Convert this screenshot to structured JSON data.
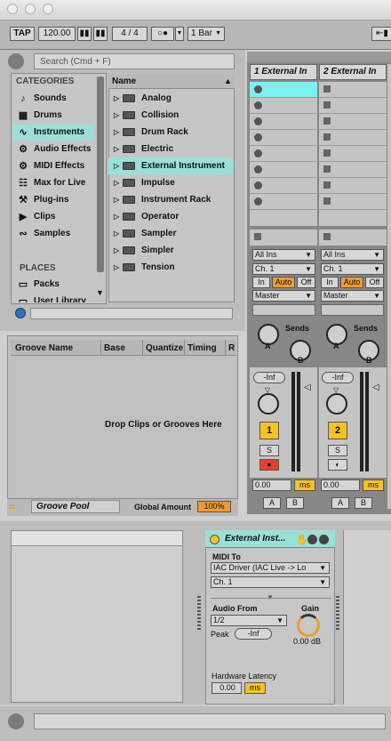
{
  "transport": {
    "tap": "TAP",
    "tempo": "120.00",
    "time_sig_num": "4",
    "time_sig_sep": "/",
    "time_sig_den": "4",
    "quantize": "1 Bar"
  },
  "browser": {
    "search_placeholder": "Search (Cmd + F)",
    "categories_title": "CATEGORIES",
    "categories": [
      {
        "label": "Sounds",
        "icon": "note-icon"
      },
      {
        "label": "Drums",
        "icon": "grid-icon"
      },
      {
        "label": "Instruments",
        "icon": "wave-icon"
      },
      {
        "label": "Audio Effects",
        "icon": "effects-icon"
      },
      {
        "label": "MIDI Effects",
        "icon": "midi-effects-icon"
      },
      {
        "label": "Max for Live",
        "icon": "max-icon"
      },
      {
        "label": "Plug-ins",
        "icon": "plugin-icon"
      },
      {
        "label": "Clips",
        "icon": "clip-icon"
      },
      {
        "label": "Samples",
        "icon": "sample-icon"
      }
    ],
    "places_title": "PLACES",
    "places": [
      {
        "label": "Packs",
        "icon": "packs-icon"
      },
      {
        "label": "User Library",
        "icon": "library-icon"
      }
    ],
    "name_header": "Name",
    "items": [
      "Analog",
      "Collision",
      "Drum Rack",
      "Electric",
      "External Instrument",
      "Impulse",
      "Instrument Rack",
      "Operator",
      "Sampler",
      "Simpler",
      "Tension"
    ]
  },
  "groove": {
    "columns": [
      "Groove Name",
      "Base",
      "Quantize",
      "Timing",
      "R"
    ],
    "empty_text": "Drop Clips or Grooves Here",
    "pool_label": "Groove Pool",
    "global_amount_label": "Global Amount",
    "global_amount_value": "100%"
  },
  "tracks": [
    {
      "name": "1 External In",
      "input_type": "All Ins",
      "input_channel": "Ch. 1",
      "monitor": [
        "In",
        "Auto",
        "Off"
      ],
      "output": "Master",
      "sends_label": "Sends",
      "send_a": "A",
      "send_b": "B",
      "volume": "-Inf",
      "number": "1",
      "solo": "S",
      "pan": "0.00",
      "pan_unit": "ms",
      "xfade_a": "A",
      "xfade_b": "B"
    },
    {
      "name": "2 External In",
      "input_type": "All Ins",
      "input_channel": "Ch. 1",
      "monitor": [
        "In",
        "Auto",
        "Off"
      ],
      "output": "Master",
      "sends_label": "Sends",
      "send_a": "A",
      "send_b": "B",
      "volume": "-Inf",
      "number": "2",
      "solo": "S",
      "pan": "0.00",
      "pan_unit": "ms",
      "xfade_a": "A",
      "xfade_b": "B"
    }
  ],
  "device": {
    "title": "External Inst...",
    "midi_to_label": "MIDI To",
    "midi_to_value": "IAC Driver (IAC Live -> Lo",
    "midi_channel": "Ch. 1",
    "audio_from_label": "Audio From",
    "audio_from_value": "1/2",
    "gain_label": "Gain",
    "gain_value": "0.00 dB",
    "peak_label": "Peak",
    "peak_value": "-Inf",
    "latency_label": "Hardware Latency",
    "latency_value": "0.00",
    "latency_unit": "ms"
  },
  "colors": {
    "accent_selected": "#9be0d8",
    "clip_highlight": "#7df0f0",
    "track_yellow": "#f3c421",
    "auto_orange": "#f29a2e",
    "arm_red": "#e5412a"
  }
}
